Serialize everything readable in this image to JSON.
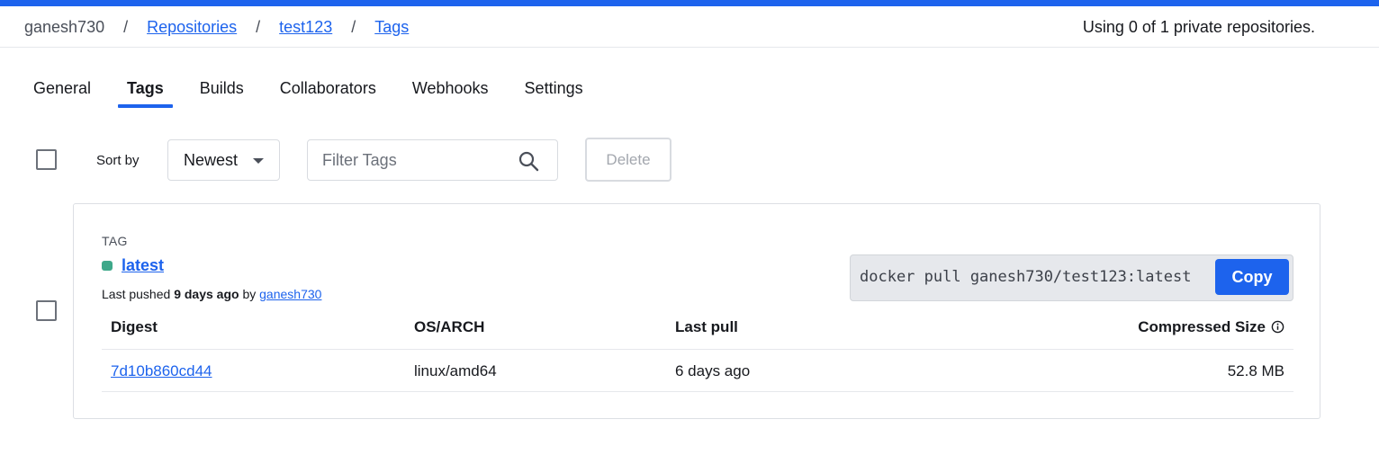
{
  "colors": {
    "accent": "#1d63ed",
    "tag_status": "#3ea88a"
  },
  "breadcrumb": {
    "owner": "ganesh730",
    "separator": "/",
    "repositories": "Repositories",
    "repo": "test123",
    "current": "Tags"
  },
  "usage_text": "Using 0 of 1 private repositories.",
  "tabs": [
    {
      "label": "General"
    },
    {
      "label": "Tags",
      "active": true
    },
    {
      "label": "Builds"
    },
    {
      "label": "Collaborators"
    },
    {
      "label": "Webhooks"
    },
    {
      "label": "Settings"
    }
  ],
  "toolbar": {
    "sort_label": "Sort by",
    "sort_value": "Newest",
    "filter_placeholder": "Filter Tags",
    "delete_label": "Delete"
  },
  "tag_card": {
    "heading": "TAG",
    "name": "latest",
    "pushed_prefix": "Last pushed",
    "pushed_time": "9 days ago",
    "pushed_by_word": "by",
    "pushed_by": "ganesh730",
    "pull_command": "docker pull ganesh730/test123:latest",
    "copy_label": "Copy",
    "table": {
      "headers": {
        "digest": "Digest",
        "os_arch": "OS/ARCH",
        "last_pull": "Last pull",
        "size": "Compressed Size"
      },
      "rows": [
        {
          "digest": "7d10b860cd44",
          "os_arch": "linux/amd64",
          "last_pull": "6 days ago",
          "size": "52.8 MB"
        }
      ]
    }
  }
}
